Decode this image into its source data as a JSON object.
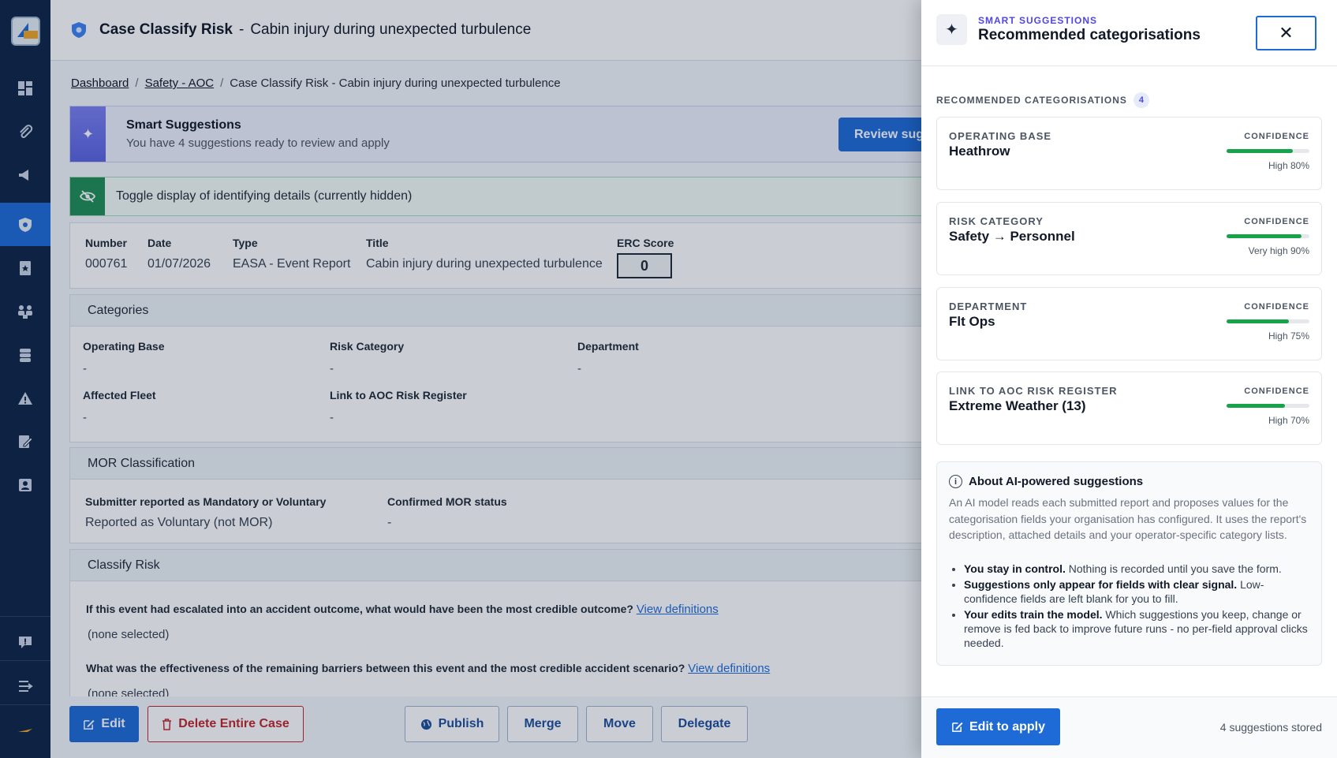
{
  "header": {
    "case_label": "Case Classify Risk",
    "separator": "-",
    "case_title": "Cabin injury during unexpected turbulence"
  },
  "breadcrumb": {
    "items": [
      "Dashboard",
      "Safety - AOC",
      "Case Classify Risk - Cabin injury during unexpected turbulence"
    ],
    "separator": "/"
  },
  "smart_banner": {
    "title": "Smart Suggestions",
    "subtitle": "You have 4 suggestions ready to review and apply",
    "button": "Review suggestions"
  },
  "toggle": {
    "label": "Toggle display of identifying details (currently hidden)"
  },
  "case_info": {
    "number_label": "Number",
    "number": "000761",
    "date_label": "Date",
    "date": "01/07/2026",
    "type_label": "Type",
    "type": "EASA - Event Report",
    "title_label": "Title",
    "title": "Cabin injury during unexpected turbulence",
    "erc_label": "ERC Score",
    "erc": "0"
  },
  "categories": {
    "heading": "Categories",
    "operating_base_label": "Operating Base",
    "operating_base": "-",
    "risk_category_label": "Risk Category",
    "risk_category": "-",
    "department_label": "Department",
    "department": "-",
    "affected_fleet_label": "Affected Fleet",
    "affected_fleet": "-",
    "risk_register_label": "Link to AOC Risk Register",
    "risk_register": "-"
  },
  "mor": {
    "heading": "MOR Classification",
    "submitter_label": "Submitter reported as Mandatory or Voluntary",
    "submitter": "Reported as Voluntary (not MOR)",
    "confirmed_label": "Confirmed MOR status",
    "confirmed": "-"
  },
  "classify": {
    "heading": "Classify Risk",
    "q1": "If this event had escalated into an accident outcome, what would have been the most credible outcome?",
    "q1_link": "View definitions",
    "q1_answer": "(none selected)",
    "q2": "What was the effectiveness of the remaining barriers between this event and the most credible accident scenario?",
    "q2_link": "View definitions",
    "q2_answer": "(none selected)"
  },
  "actions": {
    "edit": "Edit",
    "delete": "Delete Entire Case",
    "publish": "Publish",
    "merge": "Merge",
    "move": "Move",
    "delegate": "Delegate"
  },
  "drawer": {
    "eyebrow": "SMART SUGGESTIONS",
    "title": "Recommended categorisations",
    "section_label": "RECOMMENDED CATEGORISATIONS",
    "count": "4",
    "confidence_label": "CONFIDENCE",
    "recommendations": [
      {
        "label": "OPERATING BASE",
        "value": "Heathrow",
        "confidence": "High 80%",
        "level": 0.8
      },
      {
        "label": "RISK CATEGORY",
        "value": "Safety → Personnel",
        "confidence": "Very high 90%",
        "level": 0.9
      },
      {
        "label": "DEPARTMENT",
        "value": "Flt Ops",
        "confidence": "High 75%",
        "level": 0.75
      },
      {
        "label": "LINK TO AOC RISK REGISTER",
        "value": "Extreme Weather (13)",
        "confidence": "High 70%",
        "level": 0.7
      }
    ],
    "about": {
      "title": "About AI-powered suggestions",
      "body": "An AI model reads each submitted report and proposes values for the categorisation fields your organisation has configured. It uses the report's description, attached details and your operator-specific category lists.",
      "bullets": [
        {
          "strong": "You stay in control.",
          "text": " Nothing is recorded until you save the form."
        },
        {
          "strong": "Suggestions only appear for fields with clear signal.",
          "text": " Low-confidence fields are left blank for you to fill."
        },
        {
          "strong": "Your edits train the model.",
          "text": " Which suggestions you keep, change or remove is fed back to improve future runs - no per-field approval clicks needed."
        }
      ]
    },
    "apply_button": "Edit to apply",
    "stored": "4 suggestions stored"
  },
  "colors": {
    "sidebar": "#0f2447",
    "accent": "#1e6bd8",
    "success": "#16a34a",
    "danger": "#c0262d",
    "suggestion": "#4f46e5"
  }
}
